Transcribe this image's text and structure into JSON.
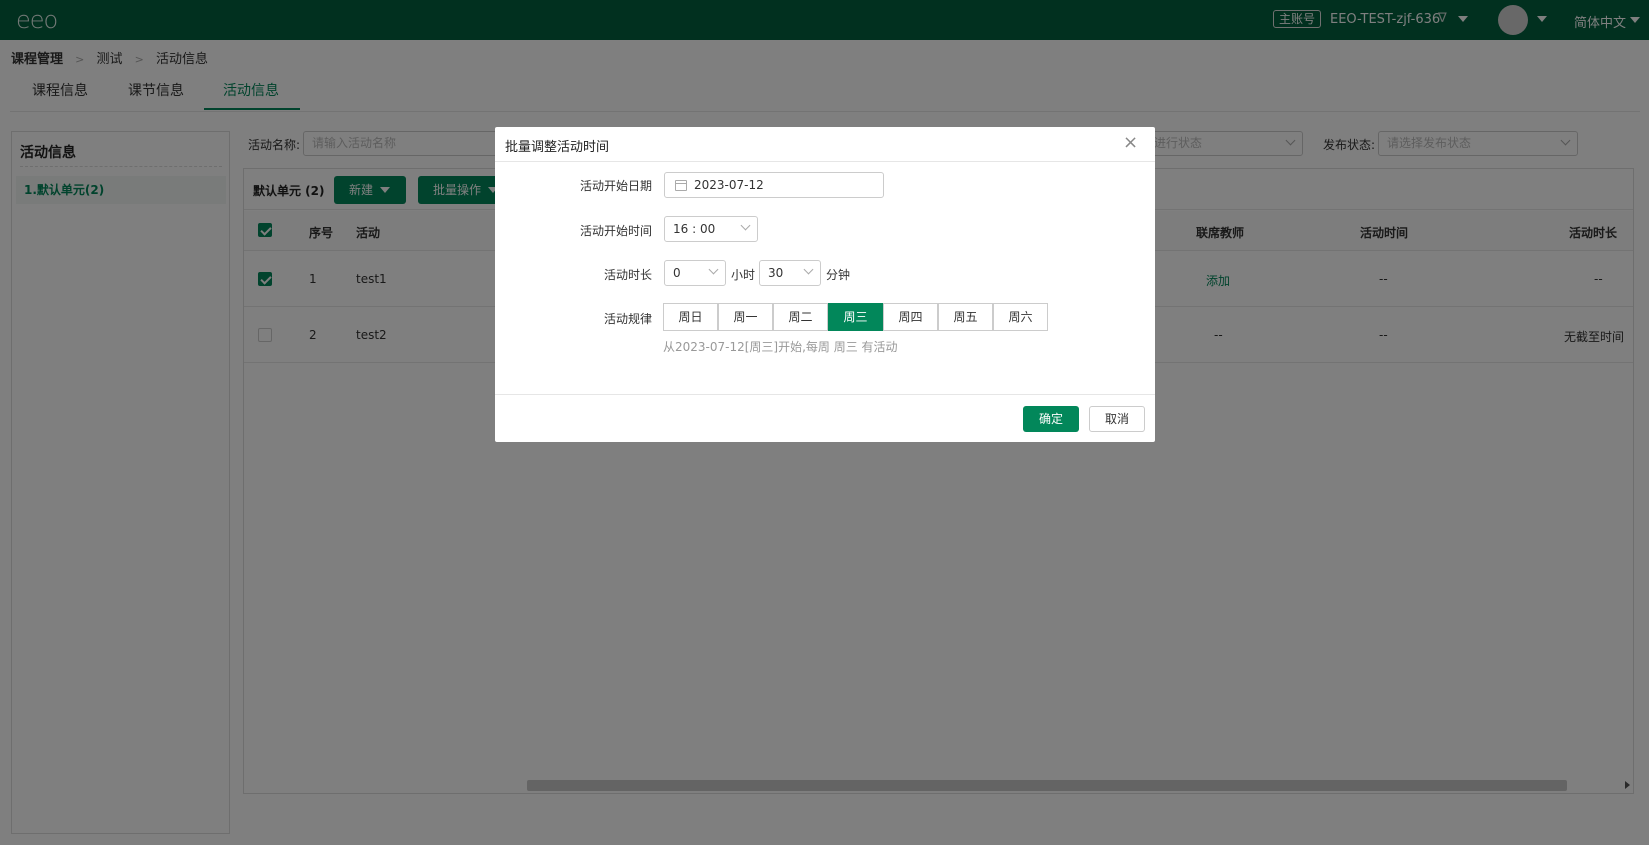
{
  "header": {
    "logo": "eeo",
    "account_badge": "主账号",
    "account_name": "EEO-TEST-zjf-636",
    "language": "简体中文"
  },
  "breadcrumb": [
    "课程管理",
    "测试",
    "活动信息"
  ],
  "tabs": [
    "课程信息",
    "课节信息",
    "活动信息"
  ],
  "active_tab": "活动信息",
  "left_panel": {
    "title": "活动信息",
    "items": [
      "1.默认单元(2)"
    ]
  },
  "filters": {
    "name_label": "活动名称:",
    "name_placeholder": "请输入活动名称",
    "run_status_placeholder": "进行状态",
    "publish_label": "发布状态:",
    "publish_placeholder": "请选择发布状态"
  },
  "table": {
    "unit_label": "默认单元 (2)",
    "new_button": "新建",
    "batch_button": "批量操作",
    "columns": [
      "序号",
      "活动",
      "联席教师",
      "活动时间",
      "活动时长"
    ],
    "rows": [
      {
        "index": "1",
        "name": "test1",
        "checked": true,
        "co_teacher": "添加",
        "time": "--",
        "duration": "--"
      },
      {
        "index": "2",
        "name": "test2",
        "checked": false,
        "co_teacher": "--",
        "time": "--",
        "duration": "无截至时间"
      }
    ]
  },
  "modal": {
    "title": "批量调整活动时间",
    "start_date_label": "活动开始日期",
    "start_date_value": "2023-07-12",
    "start_time_label": "活动开始时间",
    "start_time_value": "16 : 00",
    "duration_label": "活动时长",
    "duration_hours": "0",
    "hours_unit": "小时",
    "duration_minutes": "30",
    "minutes_unit": "分钟",
    "rule_label": "活动规律",
    "weekdays": [
      "周日",
      "周一",
      "周二",
      "周三",
      "周四",
      "周五",
      "周六"
    ],
    "selected_weekday": "周三",
    "hint": "从2023-07-12[周三]开始,每周 周三 有活动",
    "ok_button": "确定",
    "cancel_button": "取消"
  },
  "colors": {
    "header_bg": "#02613f",
    "accent": "#02875a"
  }
}
